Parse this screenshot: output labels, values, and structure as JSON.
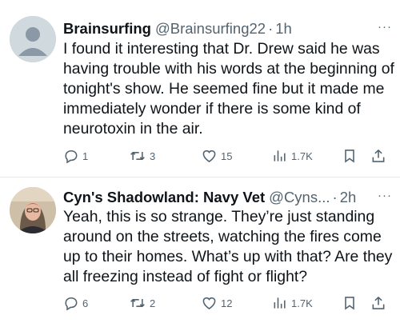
{
  "tweets": [
    {
      "display_name": "Brainsurfing",
      "handle": "@Brainsurfing22",
      "separator": "·",
      "time": "1h",
      "text": "I found it interesting that Dr. Drew said he was having trouble with his words at the beginning of tonight's show. He seemed fine but it made me immediately wonder if there is some kind of neurotoxin in the air.",
      "more": "···",
      "replies": "1",
      "reposts": "3",
      "likes": "15",
      "views": "1.7K"
    },
    {
      "display_name": "Cyn's Shadowland: Navy Vet",
      "handle": "@Cyns...",
      "separator": "·",
      "time": "2h",
      "text": "Yeah, this is so strange. They’re just standing around on the streets, watching the fires come up to their homes. What’s up with that? Are they all freezing instead of fight or flight?",
      "more": "···",
      "replies": "6",
      "reposts": "2",
      "likes": "12",
      "views": "1.7K"
    }
  ],
  "icons": {
    "reply": "reply-icon",
    "repost": "repost-icon",
    "like": "heart-icon",
    "views": "views-icon",
    "bookmark": "bookmark-icon",
    "share": "share-icon"
  },
  "colors": {
    "text": "#0f1419",
    "secondary": "#536471",
    "divider": "#e4e9ec"
  }
}
